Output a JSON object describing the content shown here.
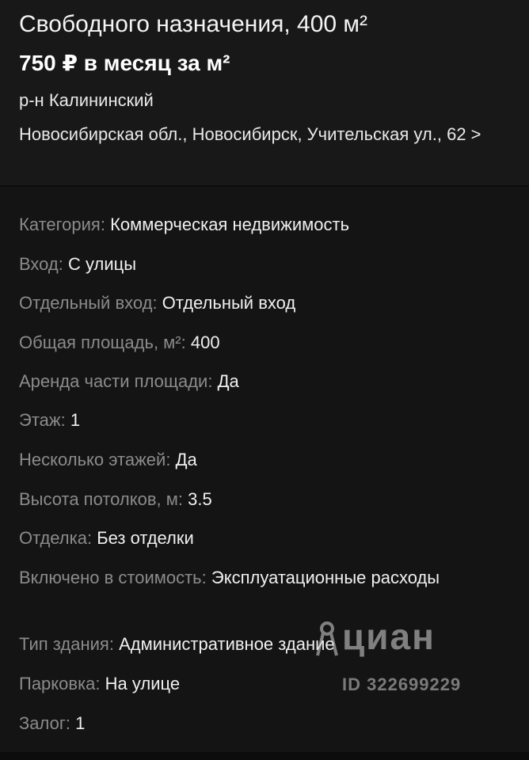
{
  "listing": {
    "title": "Свободного назначения, 400 м²",
    "price": "750 ₽ в месяц за м²",
    "district": "р-н Калининский",
    "address": "Новосибирская обл., Новосибирск, Учительская ул., 62",
    "address_chevron": ">"
  },
  "details": [
    {
      "label": "Категория:",
      "value": "Коммерческая недвижимость"
    },
    {
      "label": "Вход:",
      "value": "С улицы"
    },
    {
      "label": "Отдельный вход:",
      "value": "Отдельный вход"
    },
    {
      "label": "Общая площадь, м²:",
      "value": "400"
    },
    {
      "label": "Аренда части площади:",
      "value": "Да"
    },
    {
      "label": "Этаж:",
      "value": "1"
    },
    {
      "label": "Несколько этажей:",
      "value": "Да"
    },
    {
      "label": "Высота потолков, м:",
      "value": "3.5"
    },
    {
      "label": "Отделка:",
      "value": "Без отделки"
    },
    {
      "label": "Включено в стоимость:",
      "value": "Эксплуатационные расходы"
    },
    {
      "label": "Тип здания:",
      "value": "Административное здание"
    },
    {
      "label": "Парковка:",
      "value": "На улице"
    },
    {
      "label": "Залог:",
      "value": "1"
    }
  ],
  "watermark": {
    "logo_text": "циан",
    "id_text": "ID 322699229"
  }
}
